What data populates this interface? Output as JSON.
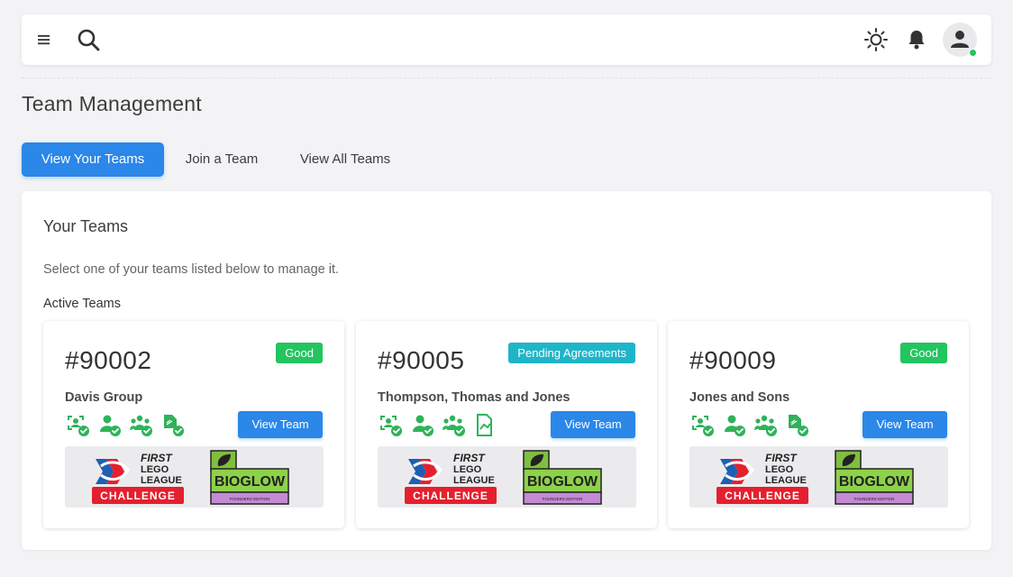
{
  "header": {
    "menu_icon": "hamburger-menu-icon",
    "search_icon": "search-icon",
    "theme_icon": "sun-icon",
    "notifications_icon": "bell-icon",
    "avatar_icon": "user-avatar-icon",
    "online_status_color": "#22c55e"
  },
  "page": {
    "title": "Team Management"
  },
  "tabs": [
    {
      "label": "View Your Teams",
      "active": true
    },
    {
      "label": "Join a Team",
      "active": false
    },
    {
      "label": "View All Teams",
      "active": false
    }
  ],
  "panel": {
    "title": "Your Teams",
    "description": "Select one of your teams listed below to manage it.",
    "section_label": "Active Teams"
  },
  "teams": [
    {
      "number": "#90002",
      "status": "Good",
      "status_type": "good",
      "name": "Davis Group",
      "view_label": "View Team",
      "icons": [
        "team-scan-check-icon",
        "user-check-icon",
        "group-check-icon",
        "document-check-icon"
      ],
      "banner": {
        "program_logo": "FIRST LEGO LEAGUE CHALLENGE",
        "season_logo": "BIOGLOW"
      }
    },
    {
      "number": "#90005",
      "status": "Pending Agreements",
      "status_type": "pending",
      "name": "Thompson, Thomas and Jones",
      "view_label": "View Team",
      "icons": [
        "team-scan-check-icon",
        "user-check-icon",
        "group-check-icon",
        "document-pending-icon"
      ],
      "banner": {
        "program_logo": "FIRST LEGO LEAGUE CHALLENGE",
        "season_logo": "BIOGLOW"
      }
    },
    {
      "number": "#90009",
      "status": "Good",
      "status_type": "good",
      "name": "Jones and Sons",
      "view_label": "View Team",
      "icons": [
        "team-scan-check-icon",
        "user-check-icon",
        "group-check-icon",
        "document-check-icon"
      ],
      "banner": {
        "program_logo": "FIRST LEGO LEAGUE CHALLENGE",
        "season_logo": "BIOGLOW"
      }
    }
  ],
  "colors": {
    "primary": "#2b87e8",
    "success": "#22c55e",
    "info": "#1fb5c9",
    "icon_green": "#2fb35a"
  }
}
